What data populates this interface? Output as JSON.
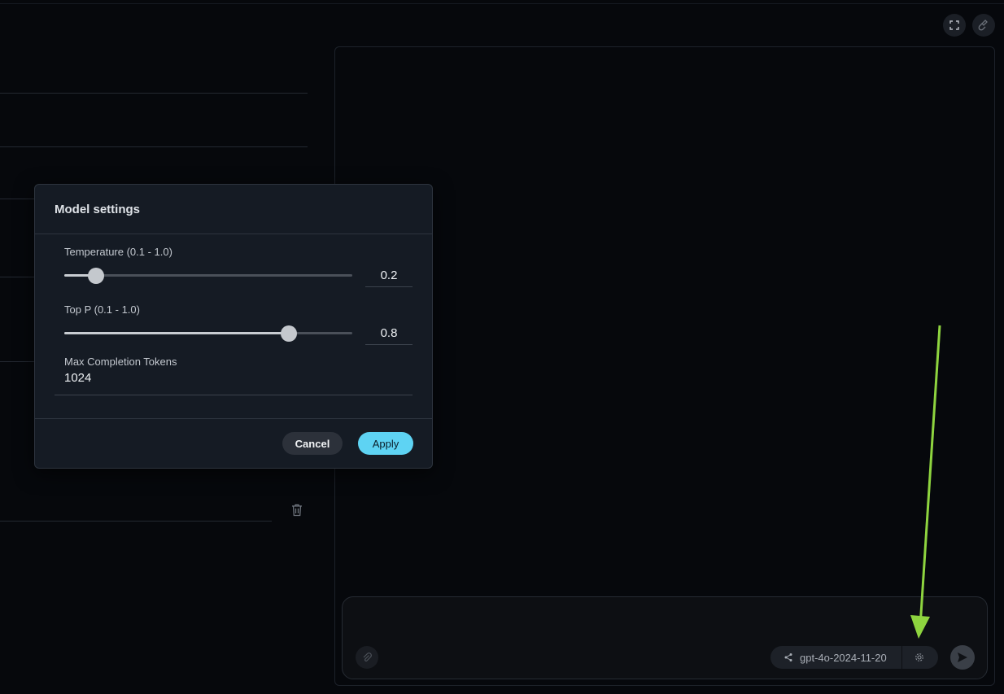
{
  "modal": {
    "title": "Model settings",
    "temperature": {
      "label": "Temperature (0.1 - 1.0)",
      "value": "0.2",
      "level": 0.11
    },
    "top_p": {
      "label": "Top P (0.1 - 1.0)",
      "value": "0.8",
      "level": 0.78
    },
    "max_tokens": {
      "label": "Max Completion Tokens",
      "value": "1024"
    },
    "cancel_label": "Cancel",
    "apply_label": "Apply"
  },
  "composer": {
    "model_name": "gpt-4o-2024-11-20"
  },
  "colors": {
    "accent": "#5ed3f3",
    "annotation_arrow": "#8ed43f",
    "background": "#06080c",
    "modal_bg": "#151b24"
  },
  "icons": [
    "expand-icon",
    "clear-icon",
    "trash-icon",
    "attach-icon",
    "share-icon",
    "gear-icon",
    "send-icon"
  ]
}
